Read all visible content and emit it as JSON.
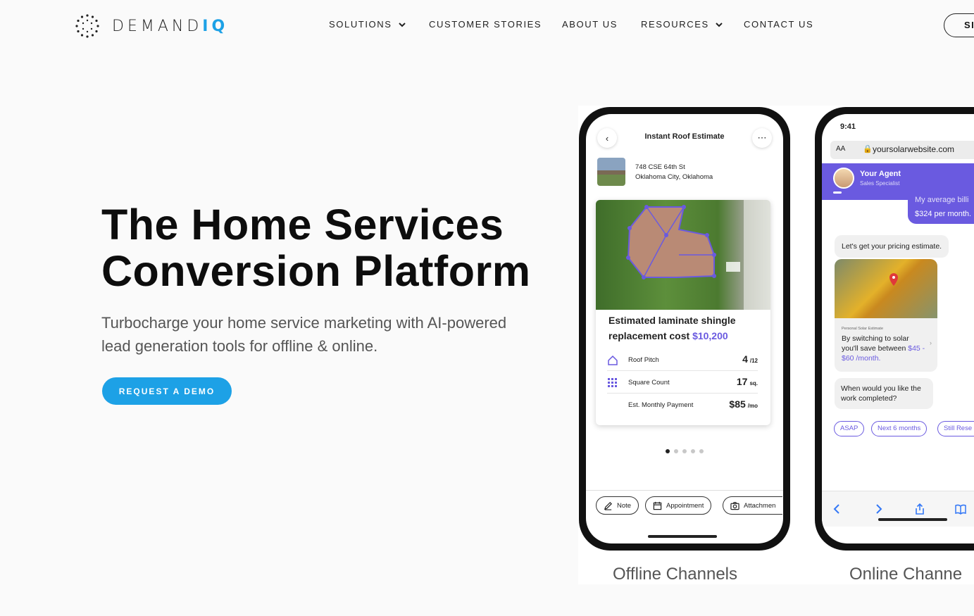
{
  "brand": {
    "name_main": "DEMAND",
    "name_accent": "IQ"
  },
  "nav": {
    "items": [
      {
        "label": "SOLUTIONS",
        "dropdown": true
      },
      {
        "label": "CUSTOMER STORIES",
        "dropdown": false
      },
      {
        "label": "ABOUT US",
        "dropdown": false
      },
      {
        "label": "RESOURCES",
        "dropdown": true
      },
      {
        "label": "CONTACT US",
        "dropdown": false
      }
    ],
    "signin_label": "SI"
  },
  "hero": {
    "title_line1": "The Home Services",
    "title_line2": "Conversion Platform",
    "subtitle": "Turbocharge your home service marketing with AI-powered lead generation tools for offline & online.",
    "cta_label": "REQUEST A DEMO"
  },
  "colors": {
    "accent": "#1da1e6",
    "purple": "#6a5ae0"
  },
  "offline_phone": {
    "title": "Instant Roof Estimate",
    "address_line1": "748 CSE 64th St",
    "address_line2": "Oklahoma City, Oklahoma",
    "estimate_text": "Estimated laminate shingle replacement cost",
    "estimate_price": "$10,200",
    "specs": [
      {
        "label": "Roof Pitch",
        "value": "4",
        "unit": "/12",
        "icon": "house-outline-icon"
      },
      {
        "label": "Square Count",
        "value": "17",
        "unit": "sq.",
        "icon": "grid-icon"
      },
      {
        "label": "Est. Monthly Payment",
        "value": "$85",
        "unit": "/mo",
        "icon": ""
      }
    ],
    "actions": [
      "Note",
      "Appointment",
      "Attachmen"
    ],
    "channel_label": "Offline Channels"
  },
  "online_phone": {
    "time": "9:41",
    "url_aa": "AA",
    "url": "yoursolarwebsite.com",
    "agent_name": "Your Agent",
    "agent_role": "Sales Specialist",
    "user_partial": "My average billi",
    "user_message": "$324 per month.",
    "bot_message1": "Let's get your pricing estimate.",
    "estimate_tag": "Personal Solar Estimate",
    "savings_text": "By switching to solar you'll save between",
    "savings_value": "$45 - $60 /month.",
    "bot_message2": "When would you like the work completed?",
    "options": [
      "ASAP",
      "Next 6 months",
      "Still Rese"
    ],
    "channel_label": "Online Channe"
  }
}
